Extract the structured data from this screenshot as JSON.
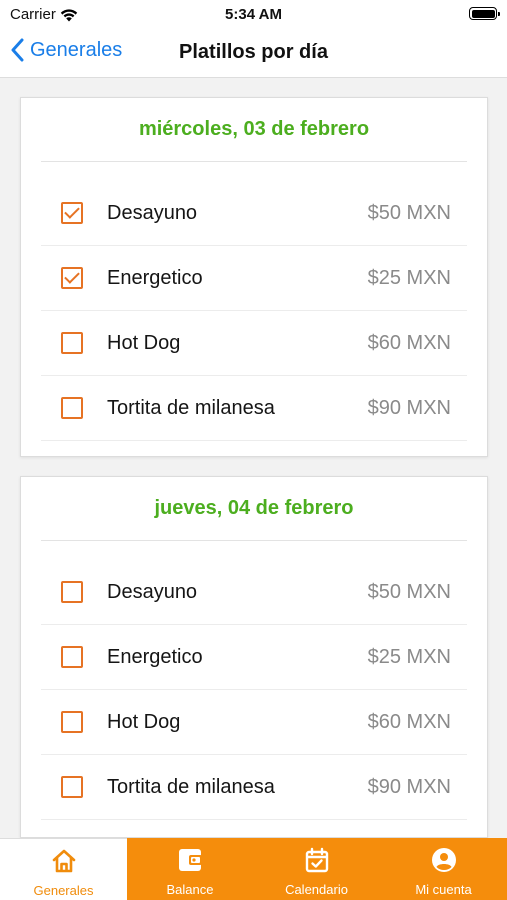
{
  "status_bar": {
    "carrier": "Carrier",
    "time": "5:34 AM"
  },
  "nav": {
    "back_label": "Generales",
    "title": "Platillos por día"
  },
  "days": [
    {
      "date": "miércoles, 03 de febrero",
      "items": [
        {
          "name": "Desayuno",
          "price": "$50 MXN",
          "checked": true
        },
        {
          "name": "Energetico",
          "price": "$25 MXN",
          "checked": true
        },
        {
          "name": "Hot Dog",
          "price": "$60 MXN",
          "checked": false
        },
        {
          "name": "Tortita de milanesa",
          "price": "$90 MXN",
          "checked": false
        }
      ]
    },
    {
      "date": "jueves, 04 de febrero",
      "items": [
        {
          "name": "Desayuno",
          "price": "$50 MXN",
          "checked": false
        },
        {
          "name": "Energetico",
          "price": "$25 MXN",
          "checked": false
        },
        {
          "name": "Hot Dog",
          "price": "$60 MXN",
          "checked": false
        },
        {
          "name": "Tortita de milanesa",
          "price": "$90 MXN",
          "checked": false
        }
      ]
    }
  ],
  "tabs": [
    {
      "label": "Generales",
      "icon": "home-icon",
      "active": true
    },
    {
      "label": "Balance",
      "icon": "wallet-icon",
      "active": false
    },
    {
      "label": "Calendario",
      "icon": "calendar-check-icon",
      "active": false
    },
    {
      "label": "Mi cuenta",
      "icon": "account-circle-icon",
      "active": false
    }
  ],
  "colors": {
    "accent_orange": "#f58d0c",
    "checkbox_orange": "#e67324",
    "date_green": "#4cae1f",
    "link_blue": "#1a7ee8"
  }
}
